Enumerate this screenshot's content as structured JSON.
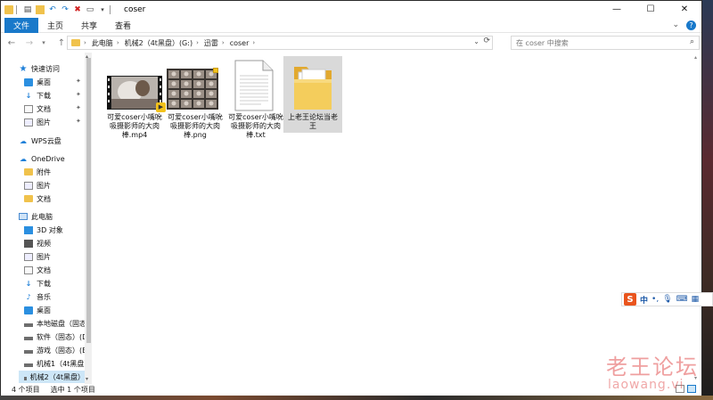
{
  "window": {
    "title": "coser",
    "controls": {
      "minimize": "—",
      "maximize": "☐",
      "close": "✕"
    }
  },
  "ribbon": {
    "tabs": [
      {
        "label": "文件",
        "active": true
      },
      {
        "label": "主页",
        "active": false
      },
      {
        "label": "共享",
        "active": false
      },
      {
        "label": "查看",
        "active": false
      }
    ]
  },
  "address": {
    "crumbs": [
      "此电脑",
      "机械2（4t黑盘）(G:)",
      "迅雷",
      "coser"
    ],
    "separator": "›"
  },
  "search": {
    "placeholder": "在 coser 中搜索"
  },
  "sidebar": {
    "items": [
      {
        "label": "快速访问",
        "icon": "star-icon",
        "pinned": false
      },
      {
        "label": "桌面",
        "icon": "desktop-icon",
        "pinned": true
      },
      {
        "label": "下载",
        "icon": "download-icon",
        "pinned": true
      },
      {
        "label": "文档",
        "icon": "document-icon",
        "pinned": true
      },
      {
        "label": "图片",
        "icon": "picture-icon",
        "pinned": true
      },
      {
        "label": "WPS云盘",
        "icon": "cloud-icon",
        "pinned": false
      },
      {
        "label": "OneDrive",
        "icon": "onedrive-icon",
        "pinned": false
      },
      {
        "label": "附件",
        "icon": "folder-icon",
        "pinned": false
      },
      {
        "label": "图片",
        "icon": "picture-icon",
        "pinned": false
      },
      {
        "label": "文档",
        "icon": "folder-icon",
        "pinned": false
      },
      {
        "label": "此电脑",
        "icon": "computer-icon",
        "pinned": false
      },
      {
        "label": "3D 对象",
        "icon": "3d-objects-icon",
        "pinned": false
      },
      {
        "label": "视频",
        "icon": "video-icon",
        "pinned": false
      },
      {
        "label": "图片",
        "icon": "picture-icon",
        "pinned": false
      },
      {
        "label": "文档",
        "icon": "document-icon",
        "pinned": false
      },
      {
        "label": "下载",
        "icon": "download-icon",
        "pinned": false
      },
      {
        "label": "音乐",
        "icon": "music-icon",
        "pinned": false
      },
      {
        "label": "桌面",
        "icon": "desktop-icon",
        "pinned": false
      },
      {
        "label": "本地磁盘（固态",
        "icon": "drive-icon",
        "pinned": false
      },
      {
        "label": "软件（固态）(D",
        "icon": "drive-icon",
        "pinned": false
      },
      {
        "label": "游戏（固态）(E",
        "icon": "drive-icon",
        "pinned": false
      },
      {
        "label": "机械1（4t黑盘）",
        "icon": "drive-icon",
        "pinned": false
      },
      {
        "label": "机械2（4t黑盘）",
        "icon": "drive-icon",
        "pinned": false,
        "selected": true
      }
    ]
  },
  "files": [
    {
      "name": "可爱coser小嘴吮吸摄影师的大肉棒.mp4",
      "lines": [
        "可爱coser小嘴吮",
        "吸摄影师的大肉",
        "棒.mp4"
      ],
      "type": "video",
      "selected": false
    },
    {
      "name": "可爱coser小嘴吮吸摄影师的大肉棒.png",
      "lines": [
        "可爱coser小嘴吮",
        "吸摄影师的大肉",
        "棒.png"
      ],
      "type": "image",
      "selected": false
    },
    {
      "name": "可爱coser小嘴吮吸摄影师的大肉棒.txt",
      "lines": [
        "可爱coser小嘴吮",
        "吸摄影师的大肉",
        "棒.txt"
      ],
      "type": "text",
      "selected": false
    },
    {
      "name": "上老王论坛当老王",
      "lines": [
        "上老王论坛当老",
        "王"
      ],
      "type": "folder",
      "selected": true
    }
  ],
  "status": {
    "count": "4 个项目",
    "selection": "选中 1 个项目"
  },
  "ime": {
    "logo": "S",
    "mode": "中"
  },
  "watermark": {
    "title": "老王论坛",
    "url": "laowang.vi"
  },
  "colors": {
    "accent": "#1979ca",
    "folder": "#f0c24c",
    "watermark": "#e15050"
  }
}
